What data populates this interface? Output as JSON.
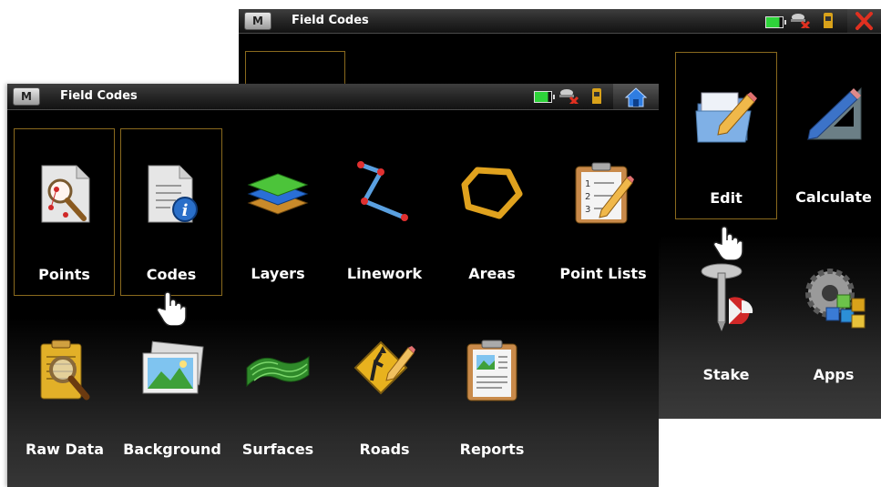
{
  "back_window": {
    "title": "Field Codes",
    "menu_label": "M",
    "items": [
      {
        "label": "Edit",
        "icon": "edit-icon"
      },
      {
        "label": "Calculate",
        "icon": "calculate-icon"
      },
      {
        "label": "Stake",
        "icon": "stake-icon"
      },
      {
        "label": "Apps",
        "icon": "apps-icon"
      }
    ]
  },
  "front_window": {
    "title": "Field Codes",
    "menu_label": "M",
    "items": [
      {
        "label": "Points",
        "icon": "points-icon"
      },
      {
        "label": "Codes",
        "icon": "codes-icon"
      },
      {
        "label": "Layers",
        "icon": "layers-icon"
      },
      {
        "label": "Linework",
        "icon": "linework-icon"
      },
      {
        "label": "Areas",
        "icon": "areas-icon"
      },
      {
        "label": "Point Lists",
        "icon": "point-lists-icon"
      },
      {
        "label": "Raw Data",
        "icon": "raw-data-icon"
      },
      {
        "label": "Background",
        "icon": "background-icon"
      },
      {
        "label": "Surfaces",
        "icon": "surfaces-icon"
      },
      {
        "label": "Roads",
        "icon": "roads-icon"
      },
      {
        "label": "Reports",
        "icon": "reports-icon"
      }
    ]
  },
  "colors": {
    "selection_border": "#8a6a1e",
    "battery": "#2ed43a",
    "close": "#e03020"
  }
}
